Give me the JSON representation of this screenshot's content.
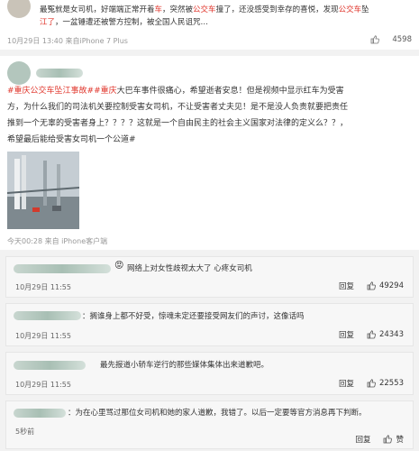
{
  "post1": {
    "text_a": "最冤就是女司机，好端端正常开着",
    "text_car1": "车",
    "text_b": "，突然被",
    "text_bus1": "公交车",
    "text_c": "撞了，还没感受到幸存的喜悦，发现",
    "text_bus2": "公交车",
    "text_d": "坠",
    "text_river": "江了",
    "text_e": "，一盆锤遭还被警方控制，被全国人民诅咒…",
    "time": "10月29日 13:40 来自iPhone 7 Plus",
    "likes": "4598"
  },
  "post2": {
    "hashtag1": "#重庆公交车坠江事故#",
    "hashtag2": "#重庆",
    "line1_rest": "大巴车事件很痛心，希望逝者安息！但是视频中显示红车为受害",
    "line2": "方，为什么我们的司法机关要控制受害女司机，不让受害者丈夫见！是不是没人负责就要把责任",
    "line3": "推到一个无辜的受害者身上？？？？这就是一个自由民主的社会主义国家对法律的定义么？？，",
    "line4": "希望最后能给受害女司机一个公道#",
    "time": "今天00:28 来自 iPhone客户端"
  },
  "comments": [
    {
      "emoji": "😡",
      "text": "网络上对女性歧视太大了 心疼女司机",
      "time": "10月29日 11:55",
      "reply": "回复",
      "likes": "49294"
    },
    {
      "text": "：搁谁身上都不好受，惊魂未定还要接受网友们的声讨，这像话吗",
      "time": "10月29日 11:55",
      "reply": "回复",
      "likes": "24343"
    },
    {
      "text": "最先报道小轿车逆行的那些媒体集体出来道歉吧。",
      "time": "10月29日 11:55",
      "reply": "回复",
      "likes": "22553"
    },
    {
      "text": "：为在心里骂过那位女司机和她的家人道歉，我错了。以后一定要等官方消息再下判断。",
      "time": "5秒前",
      "reply": "回复",
      "likes": "赞"
    }
  ]
}
